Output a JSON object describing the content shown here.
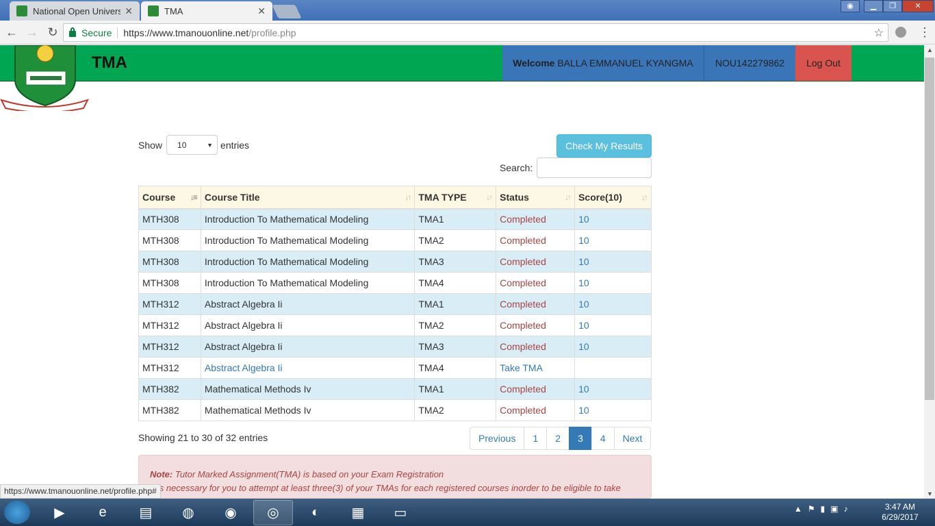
{
  "browser": {
    "tabs": [
      {
        "label": "National Open University"
      },
      {
        "label": "TMA"
      }
    ],
    "secure_label": "Secure",
    "url_host": "https://www.tmanouonline.net",
    "url_path": "/profile.php",
    "status_url": "https://www.tmanouonline.net/profile.php#"
  },
  "header": {
    "brand": "TMA",
    "welcome_bold": "Welcome",
    "welcome_name": "BALLA EMMANUEL KYANGMA",
    "reg_no": "NOU142279862",
    "logout": "Log Out"
  },
  "controls": {
    "show_label": "Show",
    "length_value": "10",
    "entries_label": "entries",
    "results_button": "Check My Results",
    "search_label": "Search:",
    "search_value": ""
  },
  "table": {
    "headers": [
      "Course",
      "Course Title",
      "TMA TYPE",
      "Status",
      "Score(10)"
    ],
    "rows": [
      {
        "course": "MTH308",
        "title": "Introduction To Mathematical Modeling",
        "type": "TMA1",
        "status": "Completed",
        "score": "10"
      },
      {
        "course": "MTH308",
        "title": "Introduction To Mathematical Modeling",
        "type": "TMA2",
        "status": "Completed",
        "score": "10"
      },
      {
        "course": "MTH308",
        "title": "Introduction To Mathematical Modeling",
        "type": "TMA3",
        "status": "Completed",
        "score": "10"
      },
      {
        "course": "MTH308",
        "title": "Introduction To Mathematical Modeling",
        "type": "TMA4",
        "status": "Completed",
        "score": "10"
      },
      {
        "course": "MTH312",
        "title": "Abstract Algebra Ii",
        "type": "TMA1",
        "status": "Completed",
        "score": "10"
      },
      {
        "course": "MTH312",
        "title": "Abstract Algebra Ii",
        "type": "TMA2",
        "status": "Completed",
        "score": "10"
      },
      {
        "course": "MTH312",
        "title": "Abstract Algebra Ii",
        "type": "TMA3",
        "status": "Completed",
        "score": "10"
      },
      {
        "course": "MTH312",
        "title": "Abstract Algebra Ii",
        "type": "TMA4",
        "status": "Take TMA",
        "score": ""
      },
      {
        "course": "MTH382",
        "title": "Mathematical Methods Iv",
        "type": "TMA1",
        "status": "Completed",
        "score": "10"
      },
      {
        "course": "MTH382",
        "title": "Mathematical Methods Iv",
        "type": "TMA2",
        "status": "Completed",
        "score": "10"
      }
    ]
  },
  "pagination": {
    "info": "Showing 21 to 30 of 32 entries",
    "previous": "Previous",
    "pages": [
      "1",
      "2",
      "3",
      "4"
    ],
    "active_page": "3",
    "next": "Next"
  },
  "note": {
    "label": "Note:",
    "line1": "Tutor Marked Assignment(TMA) is based on your Exam Registration",
    "line2": "It is necessary for you to attempt at least three(3) of your TMAs for each registered courses inorder to be eligible to take"
  },
  "taskbar": {
    "time": "3:47 AM",
    "date": "6/29/2017"
  },
  "colors": {
    "header_green": "#00a651",
    "nav_blue": "#3a75b8",
    "logout_red": "#d9534f",
    "row_highlight": "#d9edf7",
    "header_cream": "#fcf8e3",
    "completed": "#a94442",
    "link": "#337ab7",
    "results_button": "#5bc0de"
  }
}
